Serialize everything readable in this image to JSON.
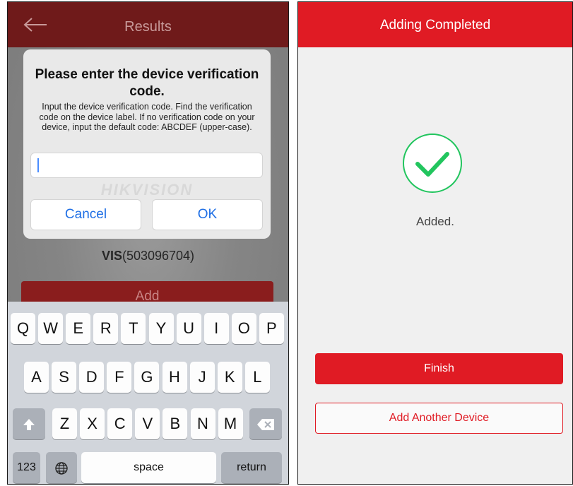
{
  "left_screen": {
    "header": {
      "title": "Results",
      "back_icon": "back-arrow-icon"
    },
    "device_label_prefix": "VIS",
    "device_label_id": "(503096704)",
    "add_button_label": "Add",
    "dialog": {
      "title": "Please enter the device verification code.",
      "body": "Input the device verification code. Find the verification code on the device label. If no verification code on your device, input the default code: ABCDEF (upper-case).",
      "input_value": "",
      "watermark": "HIKVISION",
      "cancel_label": "Cancel",
      "ok_label": "OK",
      "button_color": "#1f6fe5"
    },
    "keyboard": {
      "row1": [
        "Q",
        "W",
        "E",
        "R",
        "T",
        "Y",
        "U",
        "I",
        "O",
        "P"
      ],
      "row2": [
        "A",
        "S",
        "D",
        "F",
        "G",
        "H",
        "J",
        "K",
        "L"
      ],
      "row3": [
        "Z",
        "X",
        "C",
        "V",
        "B",
        "N",
        "M"
      ],
      "numbers_label": "123",
      "space_label": "space",
      "return_label": "return",
      "shift_icon": "shift-arrow-icon",
      "delete_icon": "backspace-icon",
      "globe_icon": "globe-icon"
    }
  },
  "right_screen": {
    "header": {
      "title": "Adding Completed",
      "color": "#e01b24"
    },
    "status_icon": "success-check-icon",
    "status_text": "Added.",
    "finish_label": "Finish",
    "add_another_label": "Add Another Device",
    "accent_color": "#e01b24",
    "success_color": "#22c55e"
  }
}
